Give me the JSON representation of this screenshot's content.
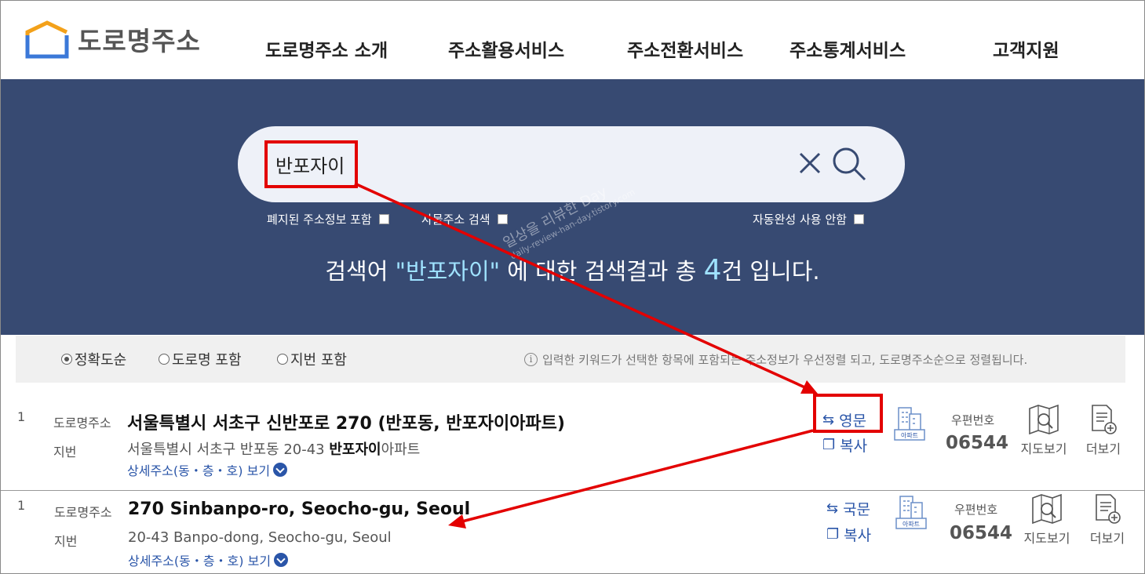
{
  "header": {
    "logo_text": "도로명주소",
    "nav": [
      "도로명주소 소개",
      "주소활용서비스",
      "주소전환서비스",
      "주소통계서비스",
      "고객지원"
    ]
  },
  "search": {
    "query": "반포자이",
    "options": {
      "abolished": "폐지된 주소정보 포함",
      "thing_address": "사물주소 검색",
      "autocomplete_off": "자동완성 사용 안함"
    },
    "result_prefix": "검색어 ",
    "result_keyword": "\"반포자이\"",
    "result_mid": " 에 대한 검색결과 총 ",
    "result_count": "4",
    "result_suffix": "건 입니다."
  },
  "sort": {
    "options": [
      "정확도순",
      "도로명 포함",
      "지번 포함"
    ],
    "selected": "정확도순",
    "note": "입력한 키워드가 선택한 항목에 포함되는 주소정보가 우선정렬 되고, 도로명주소순으로 정렬됩니다."
  },
  "results": [
    {
      "num": "1",
      "road_label": "도로명주소",
      "road_address": "서울특별시 서초구 신반포로 270 (반포동, 반포자이아파트)",
      "jibun_label": "지번",
      "jibun_prefix": "서울특별시 서초구 반포동 20-43 ",
      "jibun_bold": "반포자이",
      "jibun_suffix": "아파트",
      "detail_link": "상세주소(동・층・호) 보기",
      "lang_button": "영문",
      "copy_button": "복사",
      "building_badge": "아파트",
      "zip_label": "우편번호",
      "zip": "06544",
      "map_button": "지도보기",
      "more_button": "더보기"
    },
    {
      "num": "1",
      "road_label": "도로명주소",
      "road_address": "270 Sinbanpo-ro, Seocho-gu, Seoul",
      "jibun_label": "지번",
      "jibun_address": "20-43 Banpo-dong, Seocho-gu, Seoul",
      "detail_link": "상세주소(동・층・호) 보기",
      "lang_button": "국문",
      "copy_button": "복사",
      "building_badge": "아파트",
      "zip_label": "우편번호",
      "zip": "06544",
      "map_button": "지도보기",
      "more_button": "더보기"
    }
  ],
  "watermark": {
    "line1": "일상을 리뷰한 Day",
    "line2": "daily-review-han-day.tistory.com"
  },
  "colors": {
    "hero_bg": "#374a72",
    "accent_link": "#2a55a8",
    "highlight": "#e30000",
    "keyword": "#9fe2ff"
  }
}
